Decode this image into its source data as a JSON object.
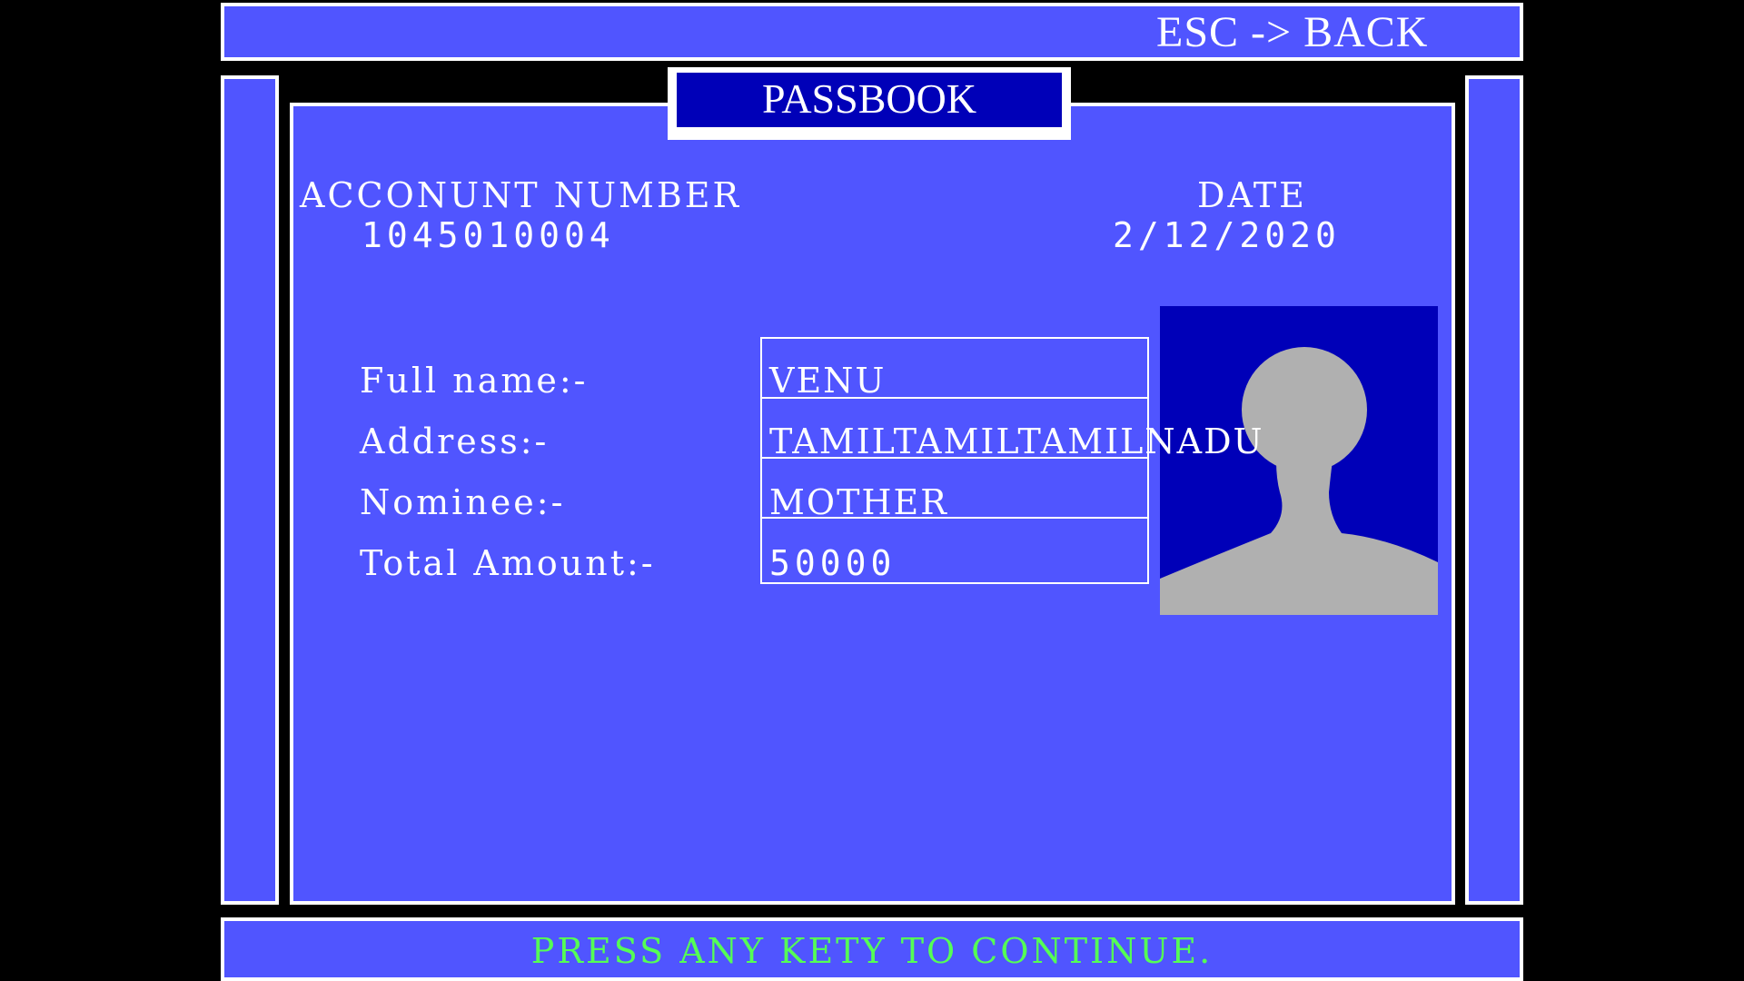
{
  "header": {
    "back_hint": "ESC -> BACK"
  },
  "title": "PASSBOOK",
  "account": {
    "label": "ACCONUNT NUMBER",
    "value": "1045010004"
  },
  "date": {
    "label": "DATE",
    "value": "2/12/2020"
  },
  "fields": [
    {
      "label": "Full name:-",
      "value": "VENU"
    },
    {
      "label": "Address:-",
      "value": "TAMILTAMILTAMILNADU"
    },
    {
      "label": "Nominee:-",
      "value": "MOTHER"
    },
    {
      "label": "Total Amount:-",
      "value": "50000"
    }
  ],
  "photo": {
    "icon": "person-silhouette-icon",
    "background_color": "#0000b8",
    "silhouette_color": "#b0b0b0"
  },
  "footer": {
    "prompt": "PRESS ANY KETY TO CONTINUE."
  },
  "colors": {
    "panel": "#5055ff",
    "border": "#ffffff",
    "title_bg": "#0000b8",
    "footer_text": "#55ff55"
  }
}
